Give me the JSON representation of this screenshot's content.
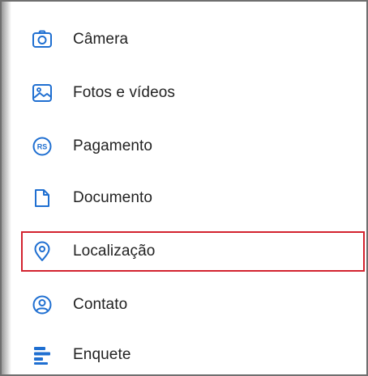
{
  "menu": {
    "items": [
      {
        "label": "Câmera",
        "icon": "camera-icon"
      },
      {
        "label": "Fotos e vídeos",
        "icon": "photos-icon"
      },
      {
        "label": "Pagamento",
        "icon": "payment-rs-icon"
      },
      {
        "label": "Documento",
        "icon": "document-icon"
      },
      {
        "label": "Localização",
        "icon": "location-pin-icon",
        "highlighted": true
      },
      {
        "label": "Contato",
        "icon": "contact-icon"
      },
      {
        "label": "Enquete",
        "icon": "poll-icon"
      }
    ]
  },
  "colors": {
    "icon_blue": "#1f6fd1",
    "highlight_red": "#d3232f",
    "text": "#222222"
  }
}
